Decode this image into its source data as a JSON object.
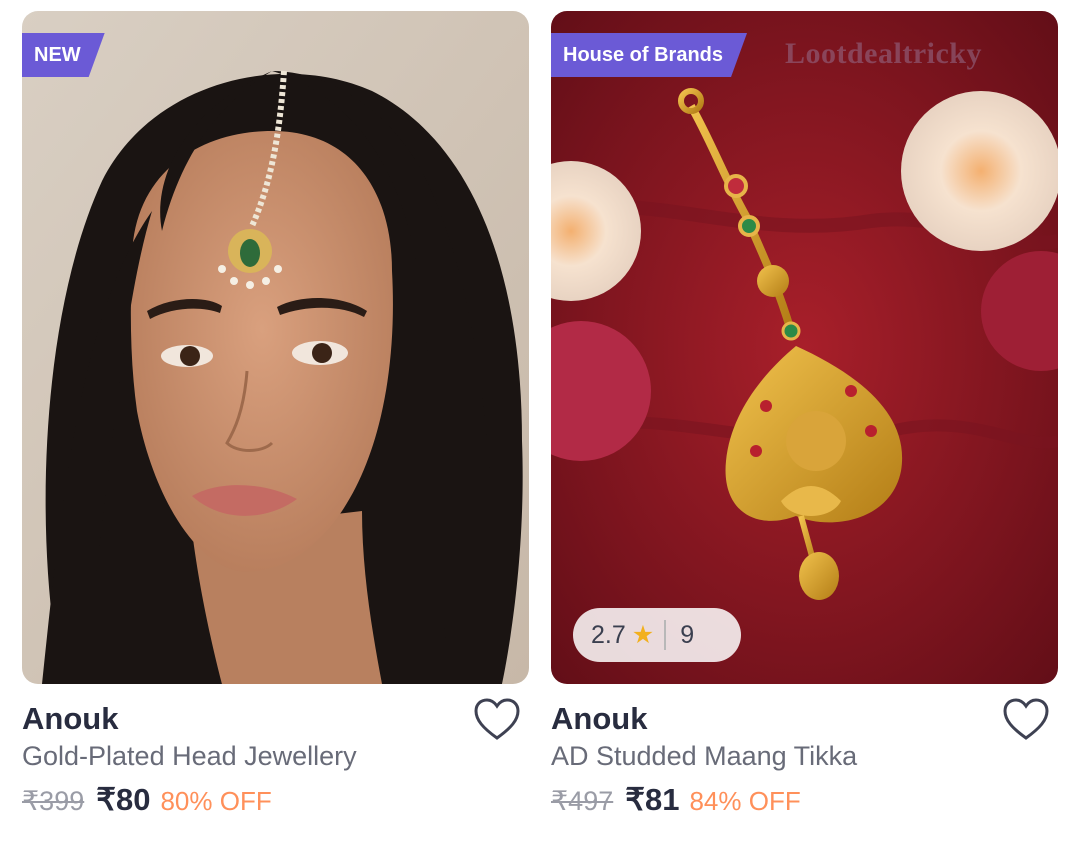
{
  "products": [
    {
      "badge": "NEW",
      "brand": "Anouk",
      "title": "Gold-Plated Head Jewellery",
      "mrp": "₹399",
      "price": "₹80",
      "discount": "80% OFF",
      "image": "woman-wearing-maang-tikka"
    },
    {
      "badge": "House of Brands",
      "watermark": "Lootdealtricky",
      "brand": "Anouk",
      "title": "AD Studded Maang Tikka",
      "mrp": "₹497",
      "price": "₹81",
      "discount": "84% OFF",
      "rating": "2.7",
      "rating_count": "9",
      "image": "gold-maang-tikka-on-red-cloth"
    }
  ],
  "icons": {
    "wishlist": "heart-outline-icon",
    "rating": "star-icon"
  },
  "colors": {
    "badge": "#6b5ad6",
    "brand_text": "#282c3f",
    "discount": "#ff905a",
    "star": "#f2b01e"
  }
}
